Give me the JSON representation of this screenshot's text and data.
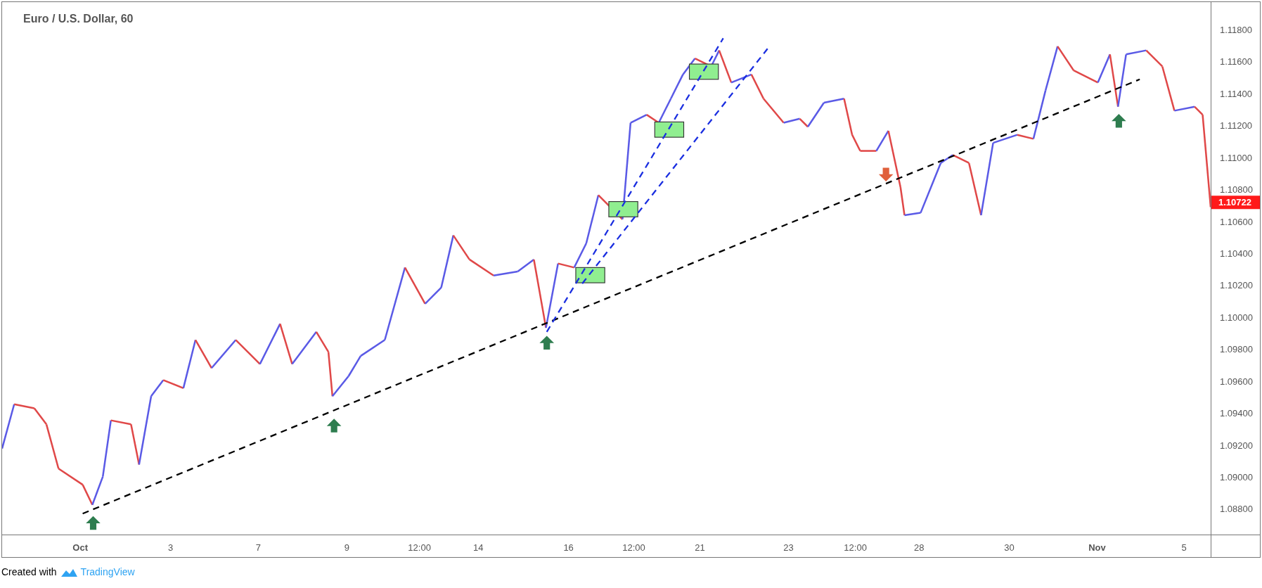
{
  "chart": {
    "title": "Euro / U.S. Dollar, 60",
    "price_axis": [
      "1.11800",
      "1.11600",
      "1.11400",
      "1.11200",
      "1.11000",
      "1.10800",
      "1.10600",
      "1.10400",
      "1.10200",
      "1.10000",
      "1.09800",
      "1.09600",
      "1.09400",
      "1.09200",
      "1.09000",
      "1.08800"
    ],
    "last_price": "1.10722",
    "time_axis": [
      {
        "label": "Oct",
        "kind": "month"
      },
      {
        "label": "3",
        "kind": "day"
      },
      {
        "label": "7",
        "kind": "day"
      },
      {
        "label": "9",
        "kind": "day"
      },
      {
        "label": "12:00",
        "kind": "day"
      },
      {
        "label": "14",
        "kind": "day"
      },
      {
        "label": "16",
        "kind": "day"
      },
      {
        "label": "12:00",
        "kind": "day"
      },
      {
        "label": "21",
        "kind": "day"
      },
      {
        "label": "23",
        "kind": "day"
      },
      {
        "label": "12:00",
        "kind": "day"
      },
      {
        "label": "28",
        "kind": "day"
      },
      {
        "label": "30",
        "kind": "day"
      },
      {
        "label": "Nov",
        "kind": "month"
      },
      {
        "label": "5",
        "kind": "day"
      }
    ]
  },
  "footer": {
    "prefix": "Created with",
    "brand": "TradingView"
  }
}
